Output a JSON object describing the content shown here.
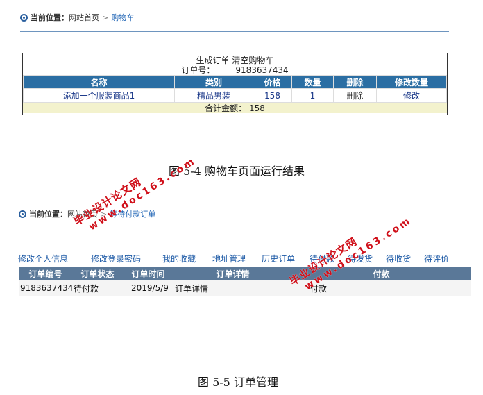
{
  "cart_page": {
    "breadcrumb": {
      "label": "当前位置：",
      "home": "网站首页",
      "sep": ">",
      "current": "购物车"
    },
    "actions": {
      "generate_order": "生成订单",
      "clear_cart": "清空购物车"
    },
    "order_no": {
      "label": "订单号：",
      "value": "9183637434"
    },
    "columns": [
      "名称",
      "类别",
      "价格",
      "数量",
      "删除",
      "修改数量"
    ],
    "rows": [
      {
        "name": "添加一个服装商品1",
        "category": "精品男装",
        "price": "158",
        "qty": "1",
        "delete": "删除",
        "modify": "修改"
      }
    ],
    "total": {
      "label": "合计金额：",
      "value": "158"
    }
  },
  "caption1": "图 5-4 购物车页面运行结果",
  "order_page": {
    "breadcrumb": {
      "label": "当前位置：",
      "home": "网站首页",
      "sep": ">",
      "current": "等待付款订单"
    },
    "tabs": [
      "修改个人信息",
      "修改登录密码",
      "我的收藏",
      "地址管理",
      "历史订单",
      "待付款",
      "待发货",
      "待收货",
      "待评价"
    ],
    "columns": [
      "订单编号",
      "订单状态",
      "订单时间",
      "订单详情",
      "付款"
    ],
    "rows": [
      {
        "order_no": "9183637434",
        "status": "待付款",
        "time": "2019/5/9",
        "detail": "订单详情",
        "pay": "付款"
      }
    ]
  },
  "caption2": "图 5-5 订单管理",
  "watermark": {
    "line1": "毕业设计论文网",
    "line2": "www.doc163.com",
    "color": "#d0101a"
  }
}
